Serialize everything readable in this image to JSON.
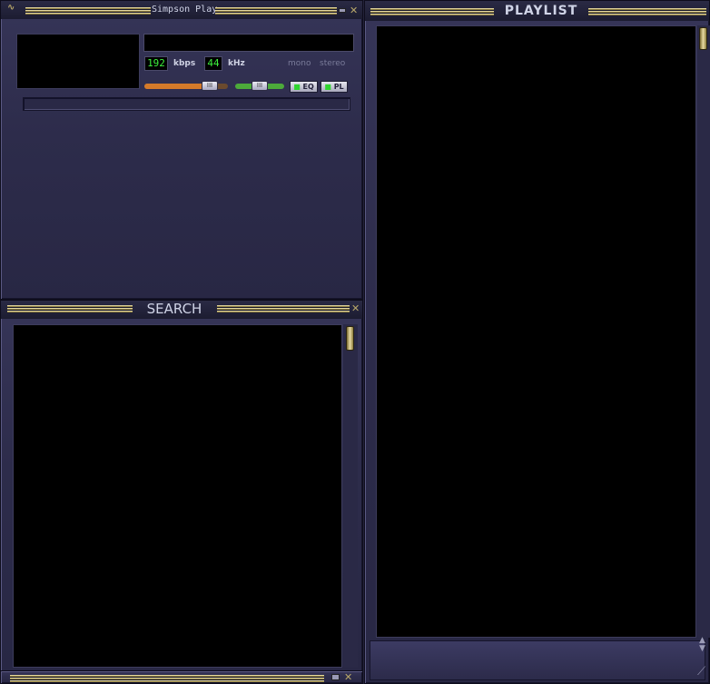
{
  "player": {
    "title": "Simpson Play",
    "bitrate_value": "192",
    "bitrate_unit": "kbps",
    "samplerate_value": "44",
    "samplerate_unit": "kHz",
    "mono_label": "mono",
    "stereo_label": "stereo",
    "eq_label": "EQ",
    "pl_label": "PL",
    "volume_level": 0.85,
    "balance_level": 0.5
  },
  "search": {
    "title": "SEARCH"
  },
  "playlist": {
    "title": "PLAYLIST"
  },
  "icons": {
    "menu": "menu-logo-icon",
    "close": "close-icon",
    "minimize": "minimize-icon",
    "resize": "resize-grip-icon",
    "scroll": "scroll-arrows-icon"
  },
  "colors": {
    "frame": "#2d2c4b",
    "gold": "#e2d59e",
    "lcd_green": "#3cf03c",
    "volume_orange": "#d47a2a",
    "balance_green": "#4caa3a"
  }
}
